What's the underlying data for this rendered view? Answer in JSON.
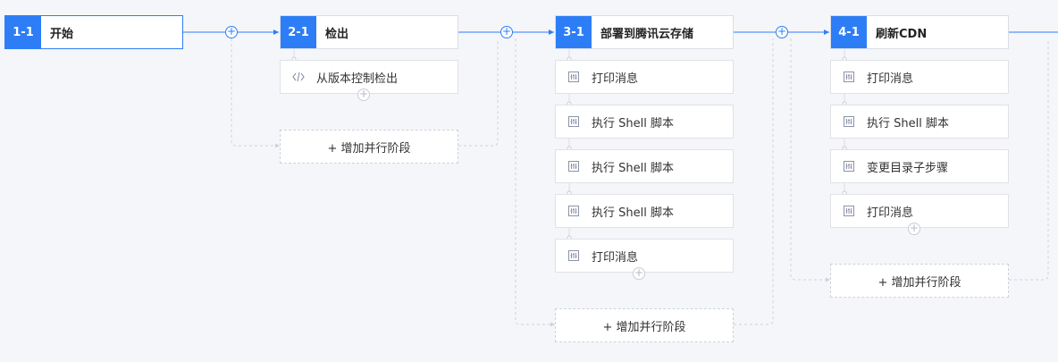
{
  "stages": [
    {
      "num": "1-1",
      "title": "开始"
    },
    {
      "num": "2-1",
      "title": "检出",
      "tasks": [
        {
          "label": "从版本控制检出",
          "icon": "code-icon"
        }
      ],
      "add_parallel": "+ 增加并行阶段"
    },
    {
      "num": "3-1",
      "title": "部署到腾讯云存储",
      "tasks": [
        {
          "label": "打印消息",
          "icon": "task-icon"
        },
        {
          "label": "执行 Shell 脚本",
          "icon": "task-icon"
        },
        {
          "label": "执行 Shell 脚本",
          "icon": "task-icon"
        },
        {
          "label": "执行 Shell 脚本",
          "icon": "task-icon"
        },
        {
          "label": "打印消息",
          "icon": "task-icon"
        }
      ],
      "add_parallel": "+ 增加并行阶段"
    },
    {
      "num": "4-1",
      "title": "刷新CDN",
      "tasks": [
        {
          "label": "打印消息",
          "icon": "task-icon"
        },
        {
          "label": "执行 Shell 脚本",
          "icon": "task-icon"
        },
        {
          "label": "变更目录子步骤",
          "icon": "task-icon"
        },
        {
          "label": "打印消息",
          "icon": "task-icon"
        }
      ],
      "add_parallel": "+ 增加并行阶段"
    }
  ],
  "colors": {
    "accent": "#2d7ef6",
    "dashed": "#cdd2db",
    "background": "#f5f6f9"
  }
}
